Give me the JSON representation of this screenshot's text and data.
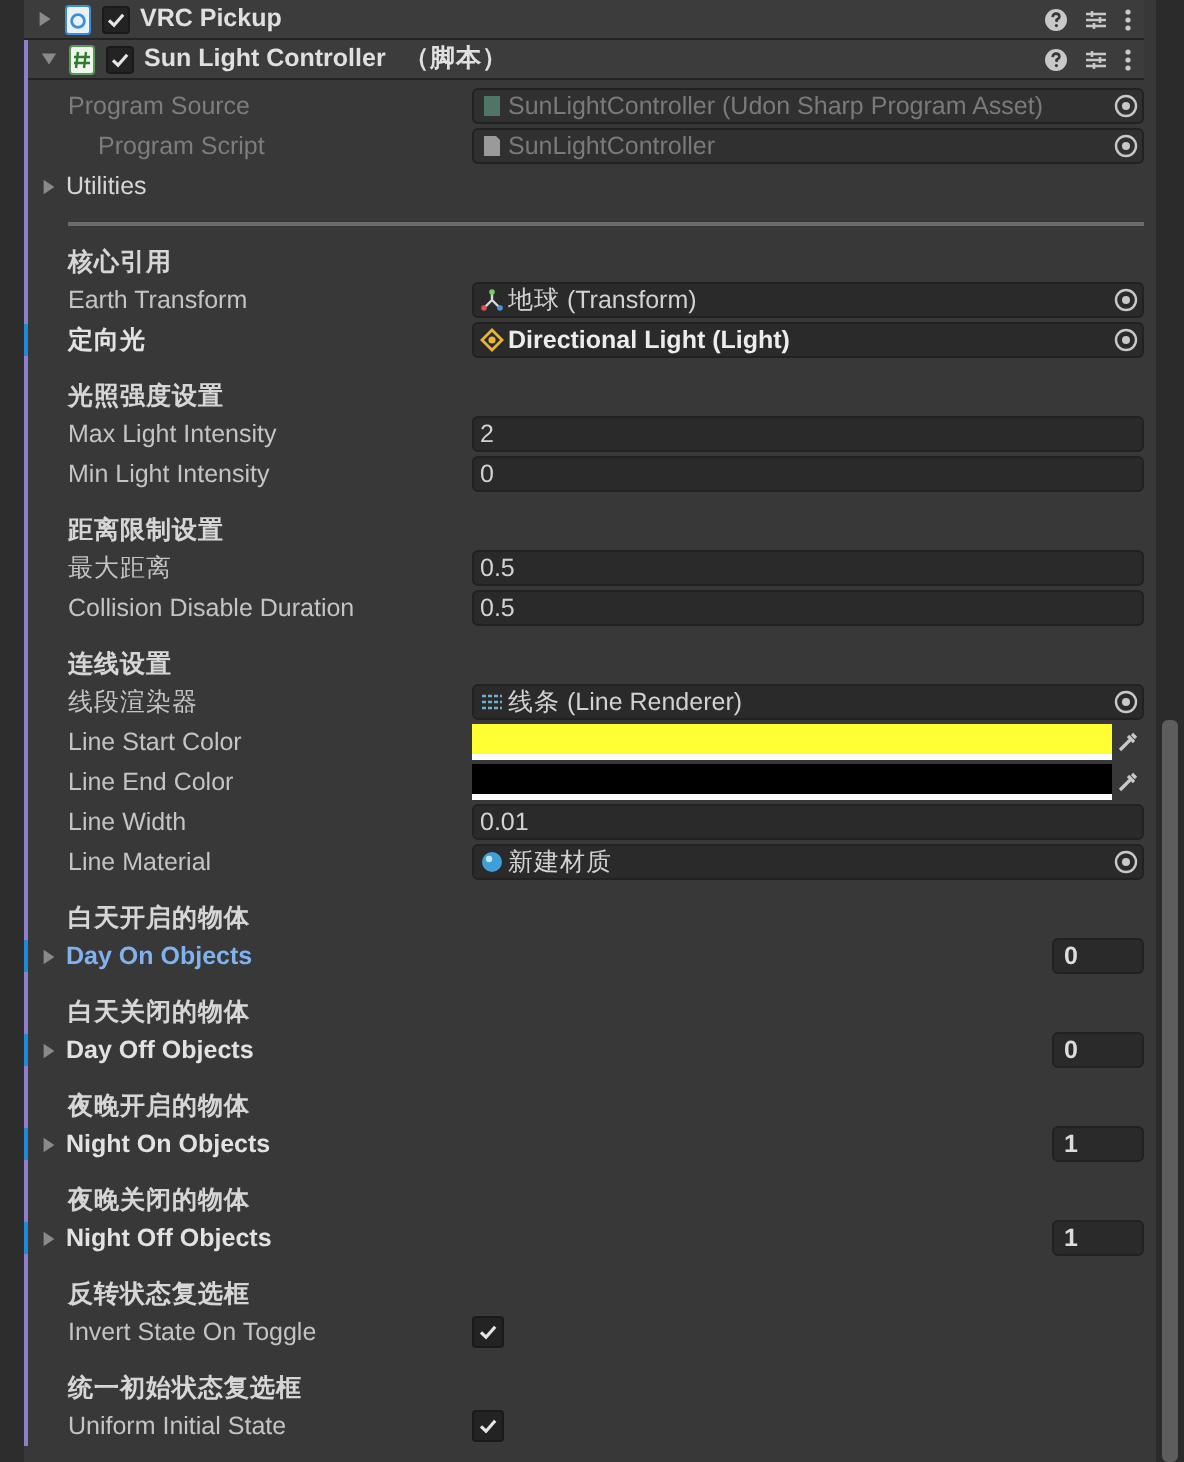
{
  "components": [
    {
      "title": "VRC Pickup",
      "expanded": false,
      "enabled": true
    },
    {
      "title": "Sun Light Controller",
      "subtitle": "（脚本）",
      "expanded": true,
      "enabled": true
    }
  ],
  "program_fields": [
    {
      "label": "Program Source",
      "value": "SunLightController (Udon Sharp Program Asset)",
      "disabled": true
    },
    {
      "label": "Program Script",
      "value": "SunLightController",
      "disabled": true
    }
  ],
  "utilities": {
    "label": "Utilities",
    "expanded": false
  },
  "sections": [
    {
      "header": "核心引用",
      "fields": [
        {
          "kind": "object",
          "label": "Earth Transform",
          "value": "地球 (Transform)",
          "overridden": false
        },
        {
          "kind": "object",
          "label": "定向光",
          "value": "Directional Light (Light)",
          "overridden": true
        }
      ]
    },
    {
      "header": "光照强度设置",
      "fields": [
        {
          "kind": "number",
          "label": "Max Light Intensity",
          "value": "2",
          "overridden": false
        },
        {
          "kind": "number",
          "label": "Min Light Intensity",
          "value": "0",
          "overridden": false
        }
      ]
    },
    {
      "header": "距离限制设置",
      "fields": [
        {
          "kind": "number",
          "label": "最大距离",
          "value": "0.5",
          "overridden": false
        },
        {
          "kind": "number",
          "label": "Collision Disable Duration",
          "value": "0.5",
          "overridden": false
        }
      ]
    },
    {
      "header": "连线设置",
      "fields": [
        {
          "kind": "object",
          "label": "线段渲染器",
          "value": "线条 (Line Renderer)",
          "overridden": false
        },
        {
          "kind": "color",
          "label": "Line Start Color",
          "color": "#ffff33",
          "overridden": false
        },
        {
          "kind": "color",
          "label": "Line End Color",
          "color": "#000000",
          "overridden": false
        },
        {
          "kind": "number",
          "label": "Line Width",
          "value": "0.01",
          "overridden": false
        },
        {
          "kind": "object",
          "label": "Line Material",
          "value": "新建材质",
          "overridden": false
        }
      ]
    },
    {
      "header": "白天开启的物体",
      "fields": [
        {
          "kind": "array",
          "label": "Day On Objects",
          "value": "0",
          "overridden": true,
          "selected": true,
          "expanded": false
        }
      ]
    },
    {
      "header": "白天关闭的物体",
      "fields": [
        {
          "kind": "array",
          "label": "Day Off Objects",
          "value": "0",
          "overridden": true,
          "selected": false,
          "expanded": false
        }
      ]
    },
    {
      "header": "夜晚开启的物体",
      "fields": [
        {
          "kind": "array",
          "label": "Night On Objects",
          "value": "1",
          "overridden": true,
          "selected": false,
          "expanded": false
        }
      ]
    },
    {
      "header": "夜晚关闭的物体",
      "fields": [
        {
          "kind": "array",
          "label": "Night Off Objects",
          "value": "1",
          "overridden": true,
          "selected": false,
          "expanded": false
        }
      ]
    },
    {
      "header": "反转状态复选框",
      "fields": [
        {
          "kind": "toggle",
          "label": "Invert State On Toggle",
          "checked": true,
          "overridden": false
        }
      ]
    },
    {
      "header": "统一初始状态复选框",
      "fields": [
        {
          "kind": "toggle",
          "label": "Uniform Initial State",
          "checked": true,
          "overridden": false
        }
      ]
    }
  ]
}
